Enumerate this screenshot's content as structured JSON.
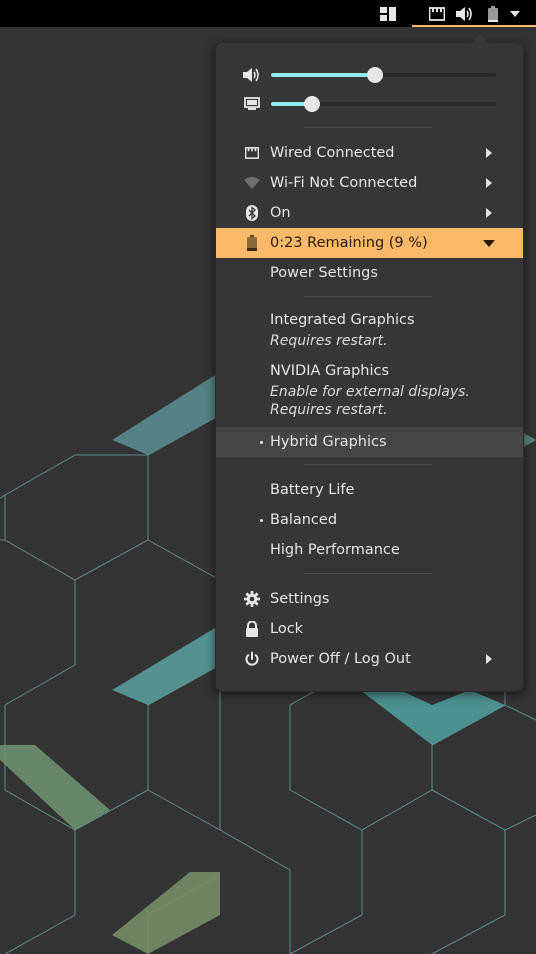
{
  "colors": {
    "accent": "#f9b969",
    "slider": "#94ebeb",
    "menu_bg": "#363636",
    "desktop_bg": "#333333"
  },
  "topbar": {
    "icons": [
      "workspaces-icon",
      "network-wired-icon",
      "volume-icon",
      "battery-icon",
      "chevron-down-icon"
    ]
  },
  "sliders": {
    "volume_level": 0.46,
    "brightness_level": 0.18
  },
  "network": {
    "wired": "Wired Connected",
    "wifi": "Wi-Fi Not Connected",
    "bluetooth": "On"
  },
  "battery": {
    "status": "0:23 Remaining (9 %)",
    "power_settings": "Power Settings"
  },
  "graphics": {
    "integrated": "Integrated Graphics",
    "integrated_note": "Requires restart.",
    "nvidia": "NVIDIA Graphics",
    "nvidia_note_1": "Enable for external displays.",
    "nvidia_note_2": "Requires restart.",
    "hybrid": "Hybrid Graphics"
  },
  "power_profiles": {
    "battery_life": "Battery Life",
    "balanced": "Balanced",
    "high_performance": "High Performance"
  },
  "system": {
    "settings": "Settings",
    "lock": "Lock",
    "power_off": "Power Off / Log Out"
  }
}
